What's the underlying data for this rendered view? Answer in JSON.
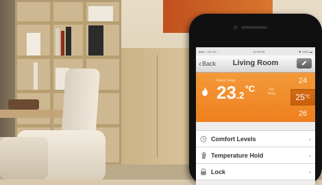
{
  "status_bar": {
    "carrier": "●●●○○ O2-UK ∷",
    "time": "10:45 PM",
    "battery": "✱ 100% ▬"
  },
  "nav": {
    "back_label": "Back",
    "title": "Living Room",
    "edit_icon": "pencil-icon"
  },
  "thermostat": {
    "room_label": "Room Temp",
    "room_temp_whole": "23",
    "room_temp_decimal": ".2",
    "room_temp_unit": "°C",
    "set_label_line1": "Set",
    "set_label_line2": "Temp",
    "setpoints": [
      "24",
      "25",
      "26"
    ],
    "selected_setpoint": "25",
    "setpoint_unit": "°C",
    "mode_icon": "flame-icon",
    "accent_color": "#f08424"
  },
  "menu": {
    "items": [
      {
        "label": "Comfort Levels",
        "icon": "clock-icon"
      },
      {
        "label": "Temperature Hold",
        "icon": "hand-icon"
      },
      {
        "label": "Lock",
        "icon": "padlock-icon"
      }
    ],
    "chevron": "›"
  }
}
